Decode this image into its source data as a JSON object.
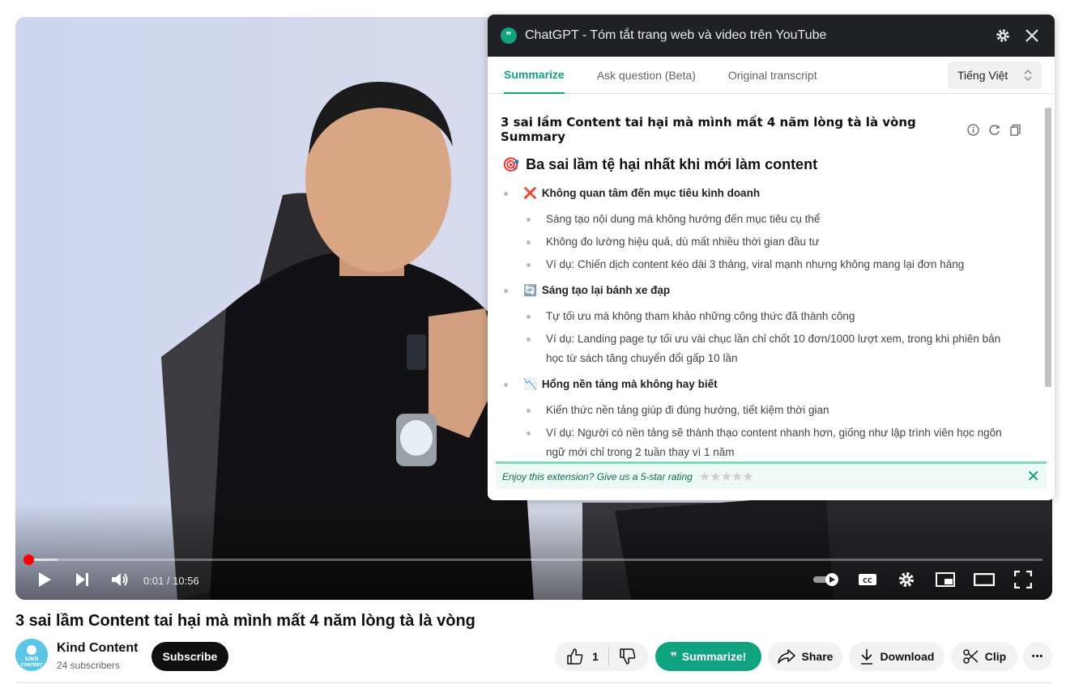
{
  "player": {
    "time_current": "0:01",
    "time_separator": "/",
    "time_total": "10:56",
    "progress_fraction": 0.0015,
    "icons": {
      "play": "play-icon",
      "next": "next-icon",
      "volume": "volume-icon",
      "autoplay": "autoplay-toggle",
      "captions": "cc-icon",
      "settings": "gear-icon",
      "miniplayer": "miniplayer-icon",
      "theater": "theater-icon",
      "fullscreen": "fullscreen-icon"
    }
  },
  "panel": {
    "logo": "❞",
    "title": "ChatGPT - Tóm tắt trang web và video trên YouTube",
    "tabs": [
      "Summarize",
      "Ask question (Beta)",
      "Original transcript"
    ],
    "language": "Tiếng Việt",
    "summary_title": "3 sai lầm Content tai hại mà mình mất 4 năm lòng tà là vòng Summary",
    "heading": {
      "emoji": "🎯",
      "text": "Ba sai lầm tệ hại nhất khi mới làm content"
    },
    "sections": [
      {
        "emoji": "❌",
        "title": "Không quan tâm đến mục tiêu kinh doanh",
        "items": [
          "Sáng tạo nội dung mà không hướng đến mục tiêu cụ thể",
          "Không đo lường hiệu quả, dù mất nhiều thời gian đầu tư",
          "Ví dụ: Chiến dịch content kéo dài 3 tháng, viral mạnh nhưng không mang lại đơn hàng"
        ]
      },
      {
        "emoji": "🔄",
        "title": "Sáng tạo lại bánh xe đạp",
        "items": [
          "Tự tối ưu mà không tham khảo những công thức đã thành công",
          "Ví dụ: Landing page tự tối ưu vài chục lần chỉ chốt 10 đơn/1000 lượt xem, trong khi phiên bản",
          "học từ sách tăng chuyển đổi gấp 10 lần"
        ]
      },
      {
        "emoji": "📉",
        "title": "Hổng nền tảng mà không hay biết",
        "items": [
          "Kiến thức nền tảng giúp đi đúng hướng, tiết kiệm thời gian",
          "Ví dụ: Người có nền tảng sẽ thành thạo content nhanh hơn, giống như lập trình viên học ngôn",
          "ngữ mới chỉ trong 2 tuần thay vì 1 năm"
        ]
      }
    ],
    "rating_text": "Enjoy this extension? Give us a 5-star rating",
    "rating_stars": "★★★★★",
    "close_symbol": "✕"
  },
  "video": {
    "title": "3 sai lầm Content tai hại mà mình mất 4 năm lòng tà là vòng",
    "channel": "Kind Content",
    "avatar_text": "KIND\nCONTENT",
    "subscribers": "24 subscribers",
    "subscribe_label": "Subscribe",
    "likes": "1",
    "summarize_label": "Summarize!",
    "summarize_prefix": "❞",
    "share_label": "Share",
    "download_label": "Download",
    "clip_label": "Clip",
    "more_symbol": "•••"
  },
  "colors": {
    "accent": "#10a37f",
    "progress": "#ff0000",
    "panel_header": "#202124"
  }
}
